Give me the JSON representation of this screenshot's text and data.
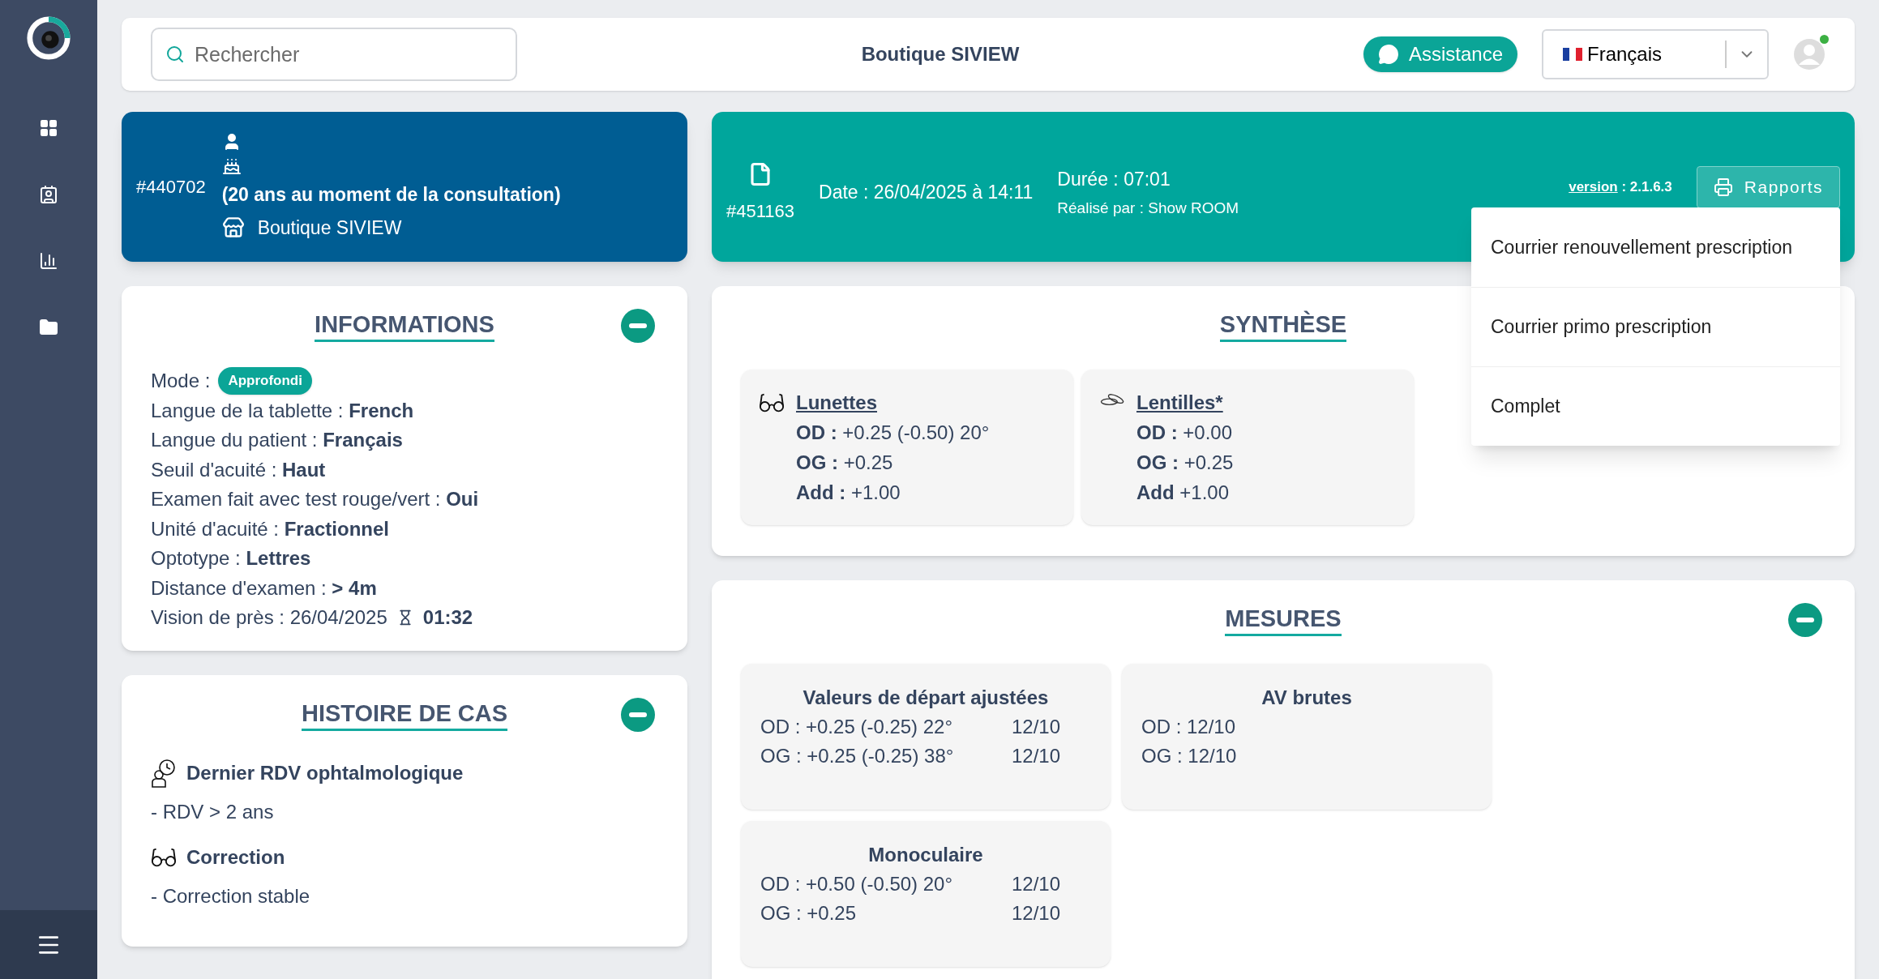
{
  "search": {
    "placeholder": "Rechercher"
  },
  "header": {
    "title": "Boutique SIVIEW",
    "assistance": "Assistance",
    "language": "Français",
    "user_online": true
  },
  "patient": {
    "id": "#440702",
    "age_note": "(20 ans au moment de la consultation)",
    "shop": "Boutique SIVIEW"
  },
  "session": {
    "id": "#451163",
    "date": "Date : 26/04/2025 à 14:11",
    "duration": "Durée : 07:01",
    "performed_by": "Réalisé par : Show ROOM",
    "version_label": "version",
    "version_value": " : 2.1.6.3",
    "reports": {
      "label": "Rapports",
      "open": true,
      "menu_items": [
        "Courrier renouvellement prescription",
        "Courrier primo prescription",
        "Complet"
      ]
    }
  },
  "informations": {
    "title": "INFORMATIONS",
    "expanded": true,
    "items": [
      {
        "kind": "badge",
        "label": "Mode :",
        "value": "Approfondi"
      },
      {
        "kind": "text",
        "text": "Langue de la tablette : **French**"
      },
      {
        "kind": "text",
        "text": "Langue du patient : **Français**"
      },
      {
        "kind": "text",
        "text": "Seuil d'acuité : **Haut**"
      },
      {
        "kind": "text",
        "text": "Examen fait avec test rouge/vert : **Oui**"
      },
      {
        "kind": "text",
        "text": "Unité d'acuité : **Fractionnel**"
      },
      {
        "kind": "text",
        "text": "Optotype : **Lettres**"
      },
      {
        "kind": "text",
        "text": "Distance d'examen : **> 4m**"
      },
      {
        "kind": "timer",
        "label": "Vision de près : 26/04/2025",
        "value": "01:32"
      }
    ]
  },
  "histoire": {
    "title": "HISTOIRE DE CAS",
    "expanded": true,
    "items": [
      {
        "kind": "appointment",
        "title": "Dernier RDV ophtalmologique",
        "detail": "- RDV > 2 ans"
      },
      {
        "kind": "glasses",
        "title": "Correction",
        "detail": "- Correction stable"
      }
    ]
  },
  "synthese": {
    "title": "SYNTHÈSE",
    "cards": [
      {
        "kind": "glasses",
        "title": "Lunettes",
        "lines": [
          "**OD :** +0.25 (-0.50) 20°",
          "**OG :** +0.25",
          "**Add :** +1.00"
        ]
      },
      {
        "kind": "lenses",
        "title": "Lentilles*",
        "lines": [
          "**OD :** +0.00",
          "**OG :** +0.25",
          "**Add** +1.00"
        ]
      }
    ]
  },
  "mesures": {
    "title": "MESURES",
    "expanded": true,
    "cards": [
      {
        "title": "Valeurs de départ ajustées",
        "rows": [
          {
            "value": "OD : +0.25 (-0.25) 22°",
            "acuity": "12/10"
          },
          {
            "value": "OG : +0.25 (-0.25) 38°",
            "acuity": "12/10"
          }
        ]
      },
      {
        "title": "AV brutes",
        "rows": [
          {
            "value": "OD : 12/10"
          },
          {
            "value": "OG : 12/10"
          }
        ]
      },
      {
        "title": "Monoculaire",
        "rows": [
          {
            "value": "OD : +0.50 (-0.50) 20°",
            "acuity": "12/10"
          },
          {
            "value": "OG : +0.25",
            "acuity": "12/10"
          }
        ]
      }
    ]
  }
}
